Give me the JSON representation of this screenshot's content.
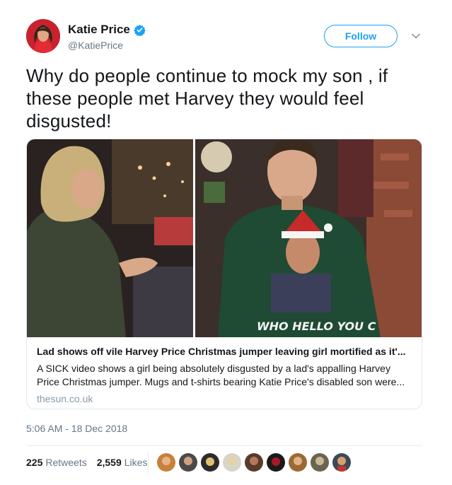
{
  "author": {
    "name": "Katie Price",
    "handle": "@KatiePrice",
    "verified": true
  },
  "follow_label": "Follow",
  "tweet_text": "Why do people continue to mock my son , if these people met Harvey they would feel disgusted!",
  "card": {
    "title": "Lad shows off vile Harvey Price Christmas jumper leaving girl mortified as it'...",
    "description": "A SICK video shows a girl being absolutely disgusted by a lad's appalling Harvey Price Christmas jumper. Mugs and t-shirts bearing Katie Price's disabled son were...",
    "domain": "thesun.co.uk",
    "jumper_text": "WHO HELLO YOU C"
  },
  "timestamp": "5:06 AM - 18 Dec 2018",
  "stats": {
    "retweets_count": "225",
    "retweets_label": "Retweets",
    "likes_count": "2,559",
    "likes_label": "Likes"
  },
  "colors": {
    "accent": "#1da1f2",
    "secondary_text": "#657786",
    "divider": "#e6ecf0"
  },
  "icons": [
    "verified-badge-icon",
    "chevron-down-icon"
  ]
}
